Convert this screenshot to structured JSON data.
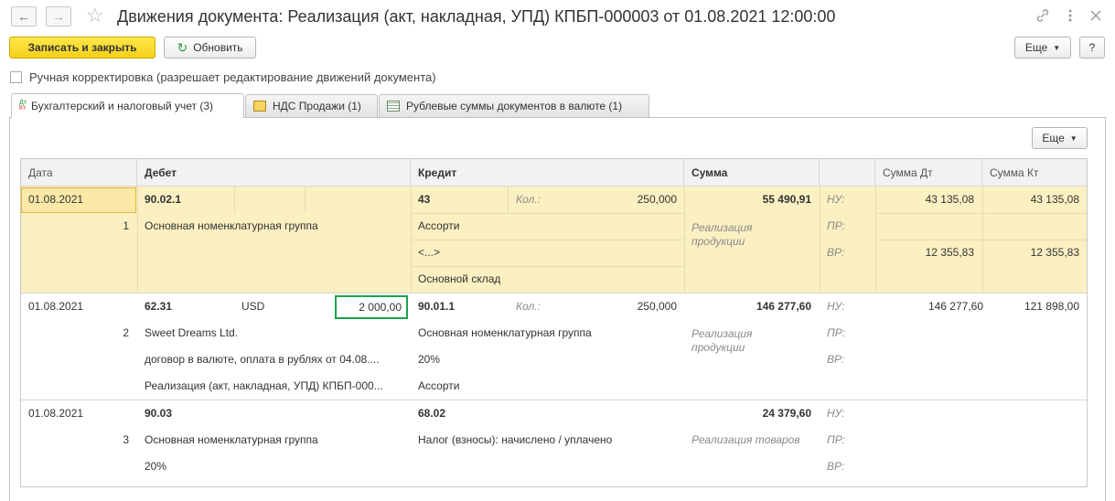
{
  "window": {
    "title": "Движения документа: Реализация (акт, накладная, УПД) КПБП-000003 от 01.08.2021 12:00:00"
  },
  "toolbar": {
    "save_close": "Записать и закрыть",
    "refresh": "Обновить",
    "more": "Еще",
    "help": "?"
  },
  "manual_correction": "Ручная корректировка (разрешает редактирование движений документа)",
  "tabs": [
    {
      "label": "Бухгалтерский и налоговый учет (3)",
      "icon": "dt-kt-icon"
    },
    {
      "label": "НДС Продажи (1)",
      "icon": "vat-sales-icon"
    },
    {
      "label": "Рублевые суммы документов в валюте (1)",
      "icon": "table-icon"
    }
  ],
  "table_more": "Еще",
  "columns": [
    "Дата",
    "Дебет",
    "Кредит",
    "Сумма",
    "",
    "Сумма Дт",
    "Сумма Кт"
  ],
  "rows": [
    {
      "date": "01.08.2021",
      "num": "1",
      "debit": [
        "90.02.1",
        "Основная номенклатурная группа"
      ],
      "credit": [
        "43",
        "Ассорти",
        "<...>",
        "Основной склад"
      ],
      "qty_label": "Кол.:",
      "qty": "250,000",
      "sum": "55 490,91",
      "content": "Реализация продукции",
      "nu": "НУ:",
      "pr": "ПР:",
      "vr": "ВР:",
      "nu_dt": "43 135,08",
      "nu_kt": "43 135,08",
      "vr_dt": "12 355,83",
      "vr_kt": "12 355,83"
    },
    {
      "date": "01.08.2021",
      "num": "2",
      "debit": [
        "62.31",
        "Sweet Dreams Ltd.",
        "договор в валюте, оплата в рублях от 04.08....",
        "Реализация (акт, накладная, УПД) КПБП-000..."
      ],
      "currency": "USD",
      "currency_amount": "2 000,00",
      "credit": [
        "90.01.1",
        "Основная номенклатурная группа",
        "20%",
        "Ассорти"
      ],
      "qty_label": "Кол.:",
      "qty": "250,000",
      "sum": "146 277,60",
      "content": "Реализация продукции",
      "nu": "НУ:",
      "pr": "ПР:",
      "vr": "ВР:",
      "nu_dt": "146 277,60",
      "nu_kt": "121 898,00"
    },
    {
      "date": "01.08.2021",
      "num": "3",
      "debit": [
        "90.03",
        "Основная номенклатурная группа",
        "20%"
      ],
      "credit": [
        "68.02",
        "Налог (взносы): начислено / уплачено"
      ],
      "sum": "24 379,60",
      "content": "Реализация товаров",
      "nu": "НУ:",
      "pr": "ПР:",
      "vr": "ВР:"
    }
  ],
  "colors": {
    "accent_yellow": "#f5cf1a",
    "selection": "#fbf0c2",
    "highlight_box": "#1aa34a"
  }
}
